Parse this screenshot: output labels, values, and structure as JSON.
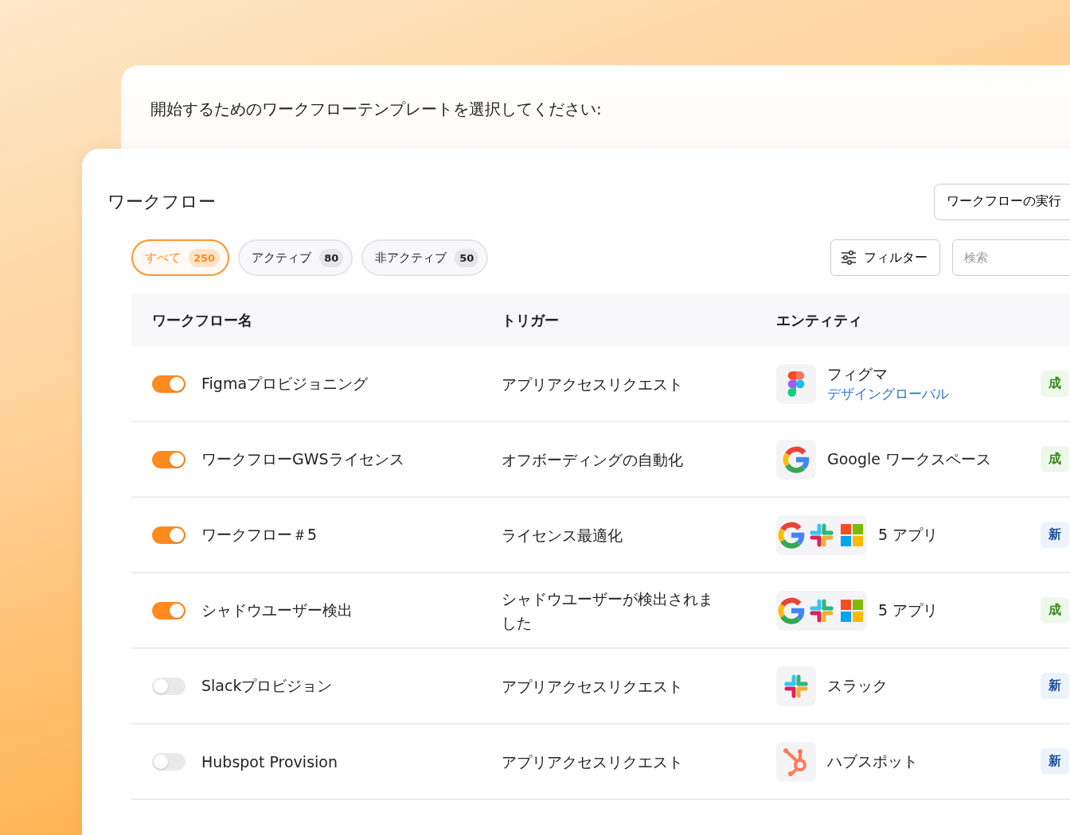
{
  "back_card": {
    "prompt": "開始するためのワークフローテンプレートを選択してください:"
  },
  "title": "ワークフロー",
  "history_button": "ワークフローの実行",
  "chips": [
    {
      "label": "すべて",
      "count": "250",
      "selected": true
    },
    {
      "label": "アクティブ",
      "count": "80",
      "selected": false
    },
    {
      "label": "非アクティブ",
      "count": "50",
      "selected": false
    }
  ],
  "filter_button": "フィルター",
  "search": {
    "placeholder": "検索"
  },
  "table": {
    "columns": [
      "ワークフロー名",
      "トリガー",
      "エンティティ"
    ],
    "rows": [
      {
        "on": true,
        "name": "Figmaプロビジョニング",
        "trigger": "アプリアクセスリクエスト",
        "logos": [
          {
            "kind": "figma"
          }
        ],
        "entity": "フィグマ",
        "entity_link": "デザイングローバル",
        "status": {
          "kind": "success",
          "text": "成"
        }
      },
      {
        "on": true,
        "name": "ワークフローGWSライセンス",
        "trigger": "オフボーディングの自動化",
        "logos": [
          {
            "kind": "google"
          }
        ],
        "entity": "Google ワークスペース",
        "status": {
          "kind": "success",
          "text": "成"
        }
      },
      {
        "on": true,
        "name": "ワークフロー＃5",
        "trigger": "ライセンス最適化",
        "logos": [
          {
            "kind": "google"
          },
          {
            "kind": "slack"
          },
          {
            "kind": "microsoft"
          }
        ],
        "entity": "5 アプリ",
        "status": {
          "kind": "new",
          "text": "新"
        }
      },
      {
        "on": true,
        "name": "シャドウユーザー検出",
        "trigger": "シャドウユーザーが検出されました",
        "logos": [
          {
            "kind": "google"
          },
          {
            "kind": "slack"
          },
          {
            "kind": "microsoft"
          }
        ],
        "entity": "5 アプリ",
        "status": {
          "kind": "success",
          "text": "成"
        }
      },
      {
        "on": false,
        "name": "Slackプロビジョン",
        "trigger": "アプリアクセスリクエスト",
        "logos": [
          {
            "kind": "slack"
          }
        ],
        "entity": "スラック",
        "status": {
          "kind": "new",
          "text": "新"
        }
      },
      {
        "on": false,
        "name": "Hubspot Provision",
        "trigger": "アプリアクセスリクエスト",
        "logos": [
          {
            "kind": "hubspot"
          }
        ],
        "entity": "ハブスポット",
        "status": {
          "kind": "new",
          "text": "新"
        }
      }
    ]
  }
}
